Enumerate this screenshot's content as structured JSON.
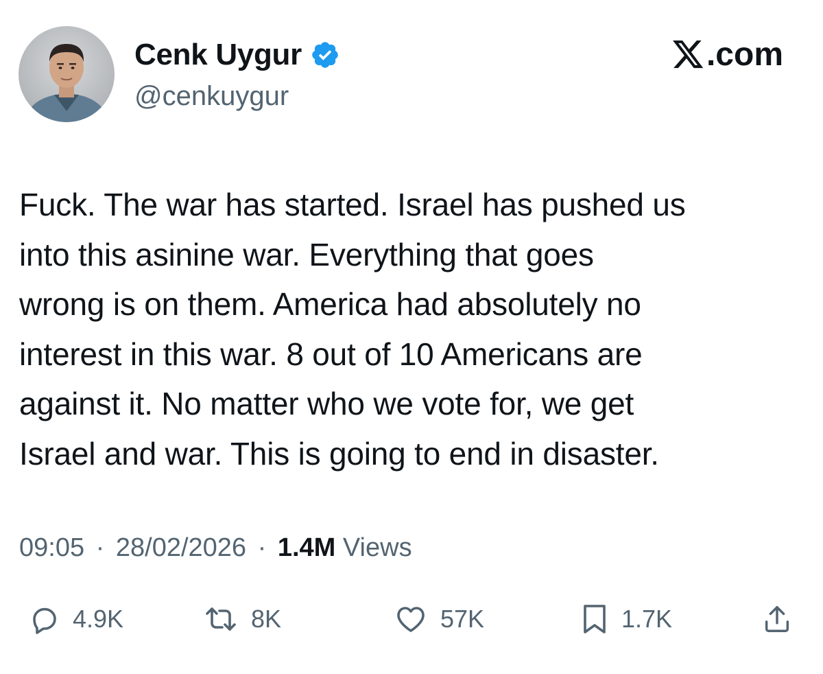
{
  "author": {
    "display_name": "Cenk Uygur",
    "handle": "@cenkuygur",
    "verified_badge_icon": "verified-badge-icon",
    "verified_color": "#1d9bf0"
  },
  "brand": {
    "logo_icon": "x-logo-icon",
    "suffix": ".com"
  },
  "tweet": {
    "text": "Fuck. The war has started. Israel has pushed us\ninto this asinine war. Everything that goes\nwrong is on them. America had absolutely no\ninterest in this war. 8 out of 10 Americans are\nagainst it. No matter who we vote for, we get\nIsrael and war. This is going to end in disaster."
  },
  "meta": {
    "time": "09:05",
    "date": "28/02/2026",
    "separator": "·",
    "views_count": "1.4M",
    "views_label": "Views"
  },
  "actions": {
    "reply": {
      "icon": "reply-icon",
      "count": "4.9K"
    },
    "repost": {
      "icon": "repost-icon",
      "count": "8K"
    },
    "like": {
      "icon": "heart-icon",
      "count": "57K"
    },
    "bookmark": {
      "icon": "bookmark-icon",
      "count": "1.7K"
    },
    "share": {
      "icon": "share-icon"
    }
  },
  "colors": {
    "text": "#0f1419",
    "secondary": "#536471",
    "background": "#ffffff"
  }
}
